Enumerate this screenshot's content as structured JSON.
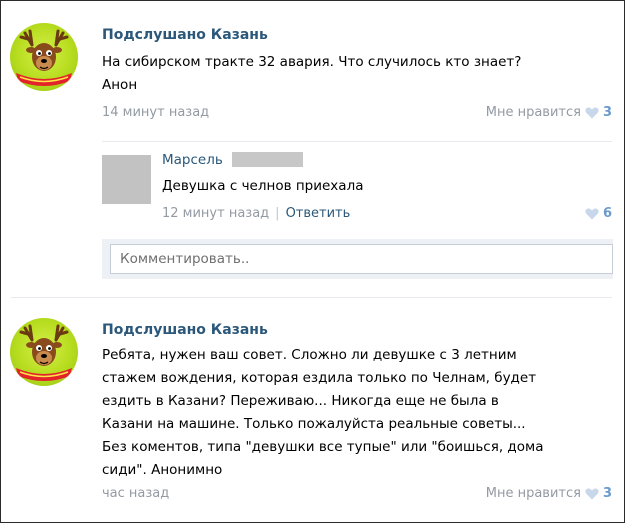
{
  "posts": [
    {
      "author": "Подслушано Казань",
      "text": "На сибирском тракте 32 авария. Что случилось кто знает?\nАнон",
      "time": "14 минут назад",
      "like_label": "Мне нравится",
      "like_count": "3",
      "comment": {
        "author": "Марсель",
        "text": "Девушка с челнов приехала",
        "time": "12 минут назад",
        "reply_label": "Ответить",
        "like_count": "6"
      },
      "comment_placeholder": "Комментировать.."
    },
    {
      "author": "Подслушано Казань",
      "text": "Ребята, нужен ваш совет. Сложно ли девушке с 3 летним\nстажем вождения, которая ездила только по Челнам, будет\nездить в Казани? Переживаю... Никогда еще не была в\nКазани на машине. Только пожалуйста реальные советы...\nБез коментов, типа \"девушки все тупые\" или \"боишься, дома\nсиди\". Анонимно",
      "time": "час назад",
      "like_label": "Мне нравится",
      "like_count": "3"
    }
  ],
  "colors": {
    "link": "#2b587a",
    "meta": "#939aa3",
    "heart": "#c8d8ea",
    "count": "#6b9acb",
    "avatar_bg": "#b6dc1e"
  }
}
